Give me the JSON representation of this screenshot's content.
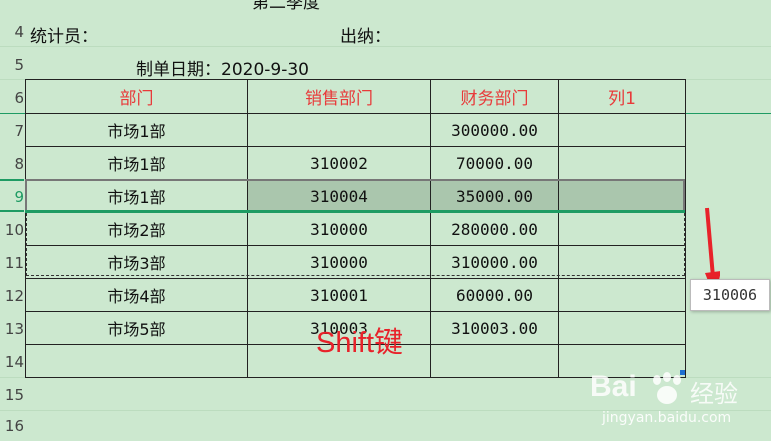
{
  "header": {
    "title_partial": "第二季度",
    "statistician_label": "统计员：",
    "cashier_label": "出纳：",
    "date_label": "制单日期：2020-9-30"
  },
  "row_numbers": [
    "4",
    "5",
    "6",
    "7",
    "8",
    "9",
    "10",
    "11",
    "12",
    "13",
    "14",
    "15",
    "16"
  ],
  "table": {
    "columns": [
      "部门",
      "销售部门",
      "财务部门",
      "列1"
    ],
    "rows": [
      {
        "dept": "市场1部",
        "sales": "",
        "finance": "300000.00",
        "col1": ""
      },
      {
        "dept": "市场1部",
        "sales": "310002",
        "finance": "70000.00",
        "col1": ""
      },
      {
        "dept": "市场1部",
        "sales": "310004",
        "finance": "35000.00",
        "col1": ""
      },
      {
        "dept": "市场2部",
        "sales": "310000",
        "finance": "280000.00",
        "col1": ""
      },
      {
        "dept": "市场3部",
        "sales": "310000",
        "finance": "310000.00",
        "col1": ""
      },
      {
        "dept": "市场4部",
        "sales": "310001",
        "finance": "60000.00",
        "col1": ""
      },
      {
        "dept": "市场5部",
        "sales": "310003",
        "finance": "310003.00",
        "col1": ""
      },
      {
        "dept": "",
        "sales": "",
        "finance": "",
        "col1": ""
      }
    ]
  },
  "tooltip_value": "310006",
  "annotation": "Shift键",
  "watermark": {
    "brand": "Bai",
    "brand_cn": "经验",
    "url": "jingyan.baidu.com"
  },
  "colors": {
    "sheet_bg": "#cce8cf",
    "header_text": "#e83a3a",
    "selection": "#1e9b63",
    "annotation": "#e8222a"
  }
}
